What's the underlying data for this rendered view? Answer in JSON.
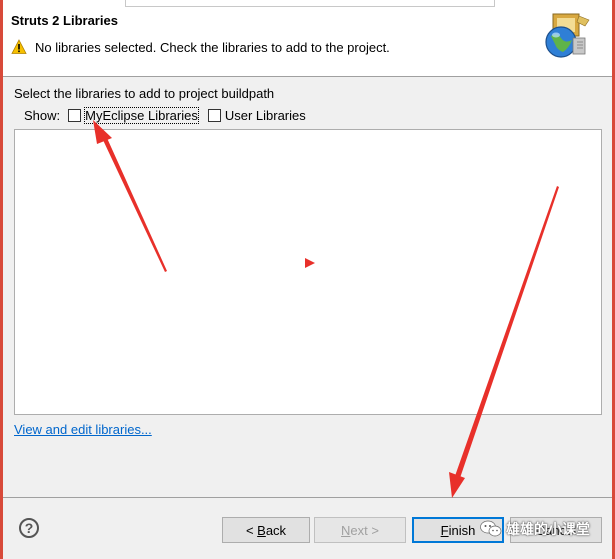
{
  "dialog": {
    "title": "Struts 2 Libraries",
    "message": "No libraries selected. Check the libraries to add to the project.",
    "icons": {
      "warning": "warning-icon",
      "banner": "globe-wizard-icon"
    }
  },
  "content": {
    "instruction": "Select the libraries to add to project buildpath",
    "show_label": "Show:",
    "filters": [
      {
        "label": "MyEclipse Libraries",
        "checked": false
      },
      {
        "label": "User Libraries",
        "checked": false
      }
    ],
    "library_list": [],
    "edit_link": "View and edit libraries..."
  },
  "footer": {
    "help_icon": "help-icon",
    "back_label": "< Back",
    "next_label": "Next >",
    "finish_label": "Finish",
    "cancel_label": "Cancel"
  },
  "watermark": {
    "text": "雄雄的小课堂"
  },
  "colors": {
    "annotation": "#e8302a",
    "link": "#0066cc",
    "default_button_border": "#0078d7"
  }
}
